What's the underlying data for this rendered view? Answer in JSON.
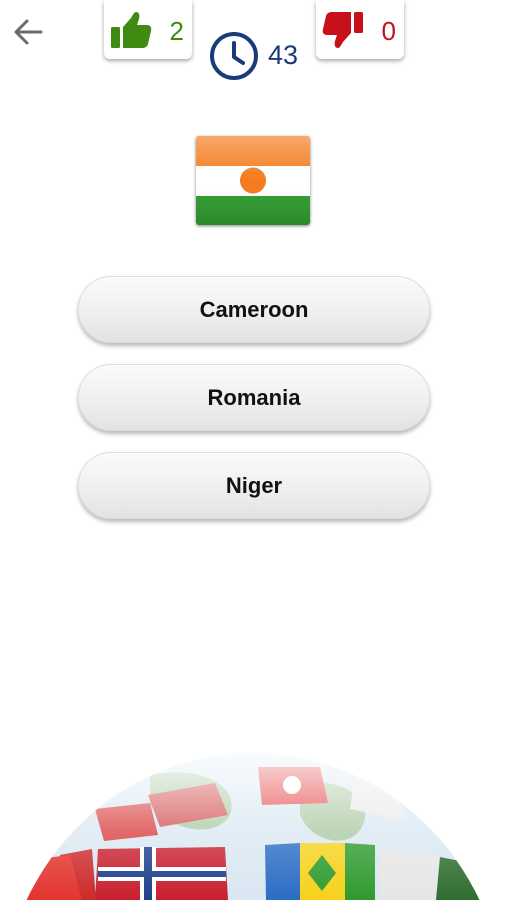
{
  "nav": {
    "back_icon": "arrow-left-icon"
  },
  "score": {
    "correct_count": "2",
    "correct_icon": "thumbs-up-icon",
    "wrong_count": "0",
    "wrong_icon": "thumbs-down-icon"
  },
  "timer": {
    "icon": "clock-icon",
    "seconds": "43"
  },
  "question": {
    "flag_icon": "niger-flag-icon"
  },
  "answers": [
    {
      "label": "Cameroon"
    },
    {
      "label": "Romania"
    },
    {
      "label": "Niger"
    }
  ],
  "decor": {
    "globe_icon": "flags-globe-icon"
  },
  "colors": {
    "correct": "#3f8a10",
    "wrong": "#c8101a",
    "timer": "#1a3a7a",
    "flag_orange": "#f47a1c",
    "flag_green": "#2f9a2f"
  }
}
